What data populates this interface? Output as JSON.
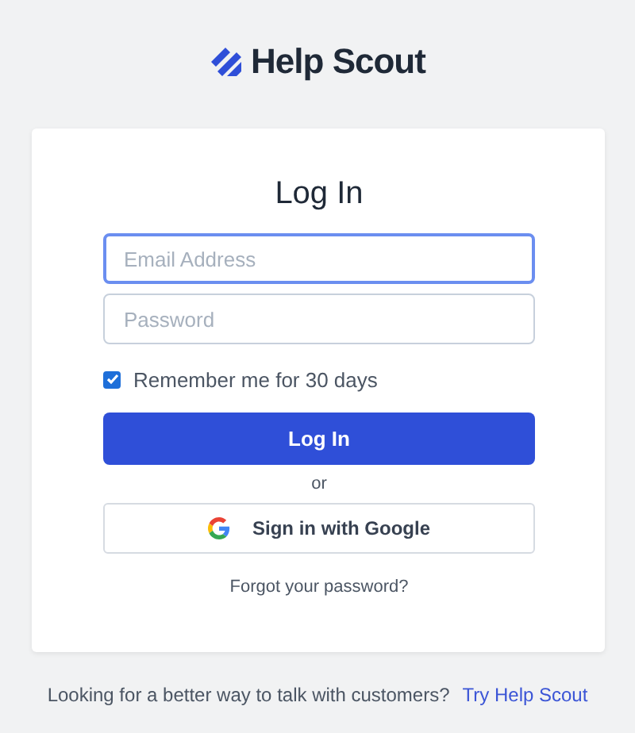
{
  "logo": {
    "text": "Help Scout"
  },
  "card": {
    "title": "Log In",
    "fields": [
      {
        "placeholder": "Email Address",
        "focused": true
      },
      {
        "placeholder": "Password",
        "focused": false
      }
    ],
    "remember": {
      "label": "Remember me for 30 days",
      "checked": true
    },
    "login_button": "Log In",
    "divider": "or",
    "google_button": "Sign in with Google",
    "forgot_link": "Forgot your password?"
  },
  "footer": {
    "text": "Looking for a better way to talk with customers?",
    "link": "Try Help Scout"
  }
}
